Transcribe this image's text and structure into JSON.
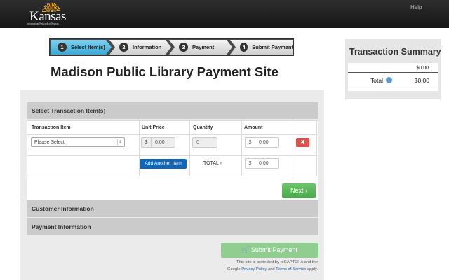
{
  "header": {
    "logo_word": "Kansas",
    "logo_sub": "Information Network of Kansas",
    "help_label": "Help"
  },
  "steps": [
    {
      "num": "1",
      "label": "Select Item(s)"
    },
    {
      "num": "2",
      "label": "Information"
    },
    {
      "num": "3",
      "label": "Payment"
    },
    {
      "num": "4",
      "label": "Submit Payment"
    }
  ],
  "page_title": "Madison Public Library Payment Site",
  "summary": {
    "title": "Transaction Summary",
    "subtotal": "$0.00",
    "total_label": "Total",
    "info_icon_glyph": "i",
    "total_value": "$0.00"
  },
  "select_section": {
    "heading": "Select Transaction Item(s)",
    "columns": [
      "Transaction Item",
      "Unit Price",
      "Quantity",
      "Amount"
    ],
    "row": {
      "item_placeholder": "Please Select",
      "select_arrow_glyph": "⇕",
      "unit_currency": "$",
      "unit_price": "0.00",
      "quantity": "0",
      "amount_currency": "$",
      "amount": "0.00",
      "delete_glyph": "✖"
    },
    "add_button": "Add Another Item",
    "total_label": "TOTAL ›",
    "total_currency": "$",
    "total_value": "0.00",
    "next_button": "Next ›"
  },
  "customer_heading": "Customer Information",
  "payment_heading": "Payment Information",
  "submit_button": "🛒 Submit Payment",
  "captcha": {
    "line1": "This site is protected by reCAPTCHA and the",
    "line2_pre": "Google",
    "privacy": "Privacy Policy",
    "and": "and",
    "terms": "Terms of Service",
    "apply": "apply."
  }
}
